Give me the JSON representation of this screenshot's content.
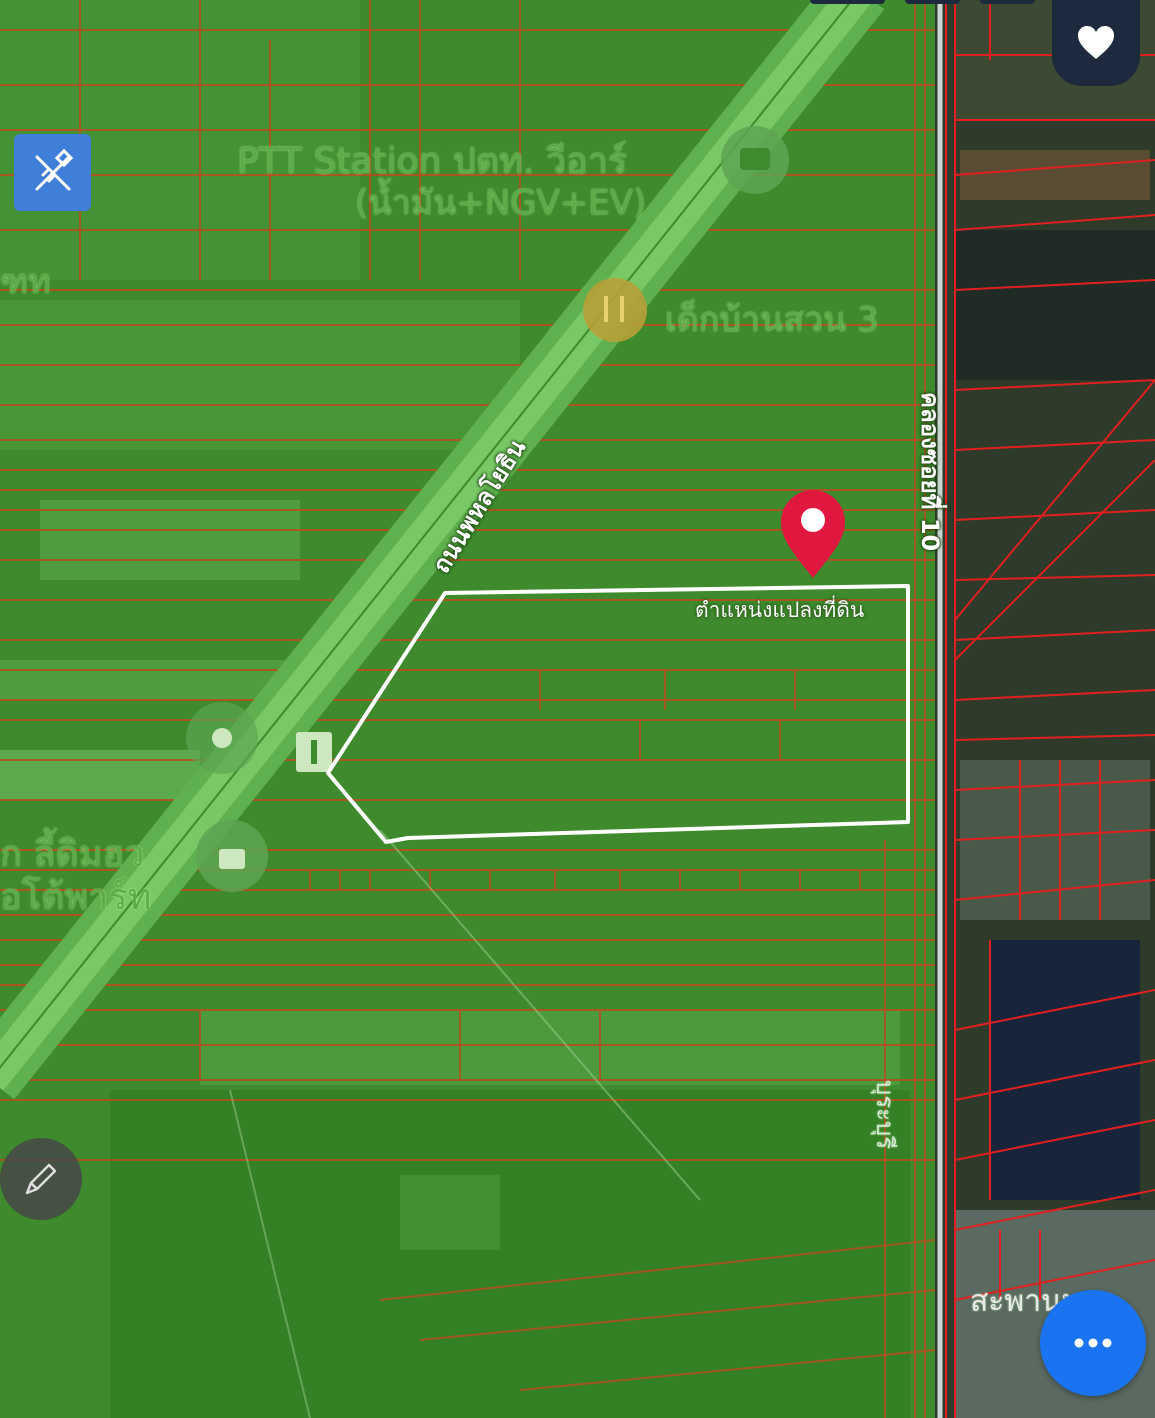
{
  "labels": {
    "ptt_station_line1": "PTT Station ปตท. วีอาร์",
    "ptt_station_line2": "(น้ำมัน+NGV+EV)",
    "restaurant": "เด็กบ้านสวน 3",
    "left_top_fragment": "ฑท",
    "left_mid_line1": "ก ลี้ดิมฮว",
    "left_mid_line2": "อโต้พาร์ท",
    "bottom_right_fragment": "สะพานหล",
    "right_vertical_fragment": "บุระบุรี"
  },
  "roads": {
    "highway": "ถนนพหลโยธิน",
    "canal": "คลองซอยที่ 10"
  },
  "parcel": {
    "label": "ตำแหน่งแปลงที่ดิน"
  },
  "colors": {
    "zone_green": "#3e8a2c",
    "parcel_lines": "#b4501e",
    "outline": "#ffffff",
    "pin": "#e0173f",
    "fab": "#1a73f0",
    "tool_button": "#3f7fd9",
    "heart_button": "#1d2a3d"
  },
  "icons": {
    "tool": "ruler-pencil-icon",
    "favorite": "heart-icon",
    "edit": "pencil-icon",
    "more": "more-dots-icon",
    "pin": "map-pin-icon",
    "gas": "gas-station-icon",
    "restaurant": "fork-knife-icon",
    "info": "info-icon",
    "shopping": "shopping-bag-icon"
  }
}
